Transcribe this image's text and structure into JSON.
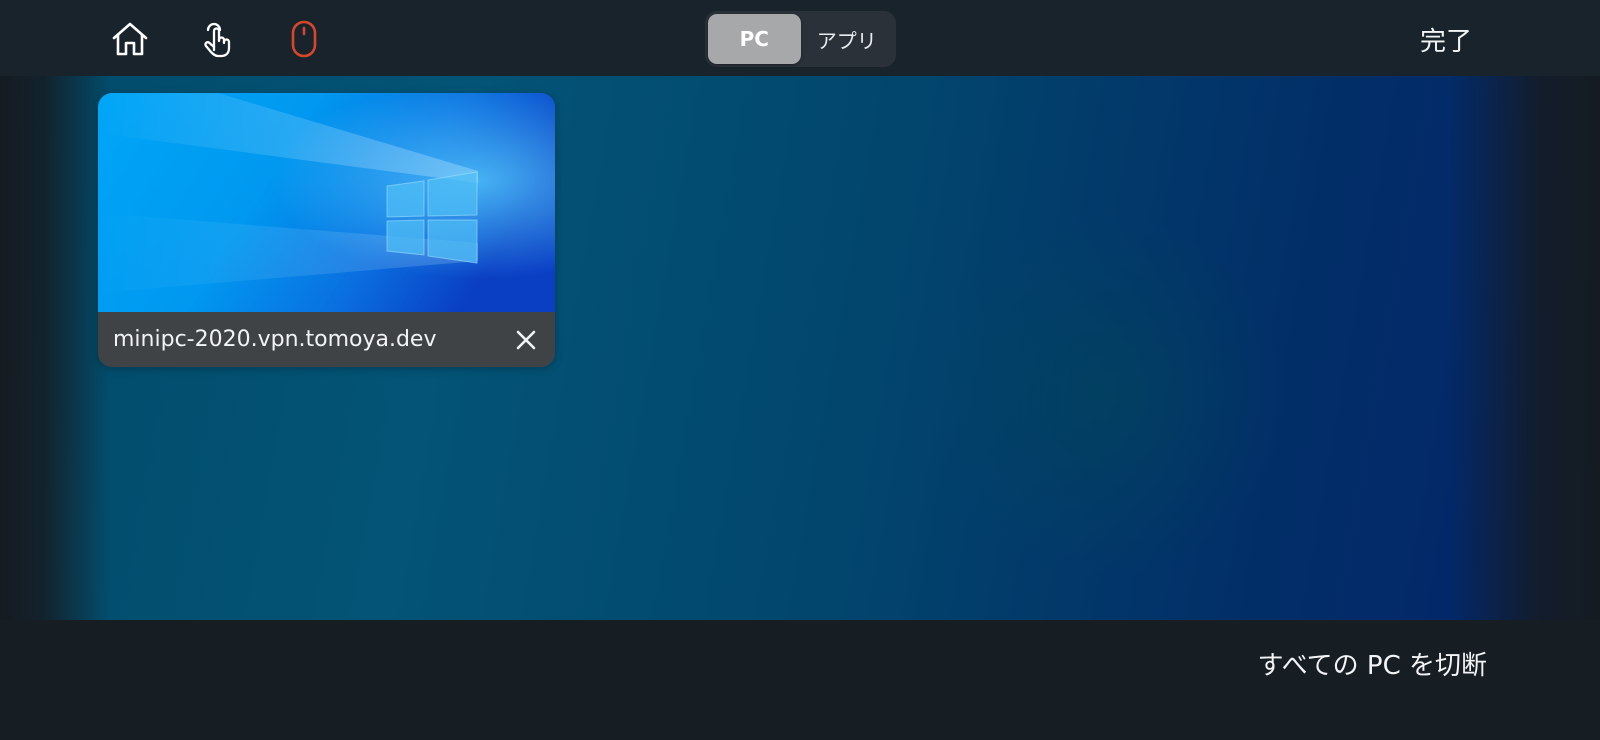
{
  "toolbar": {
    "icons": [
      "home-icon",
      "touch-hand-icon",
      "mouse-icon"
    ],
    "mouse_icon_color": "#d9472b",
    "segments": [
      {
        "label": "PC",
        "selected": true
      },
      {
        "label": "アプリ",
        "selected": false
      }
    ],
    "done_label": "完了"
  },
  "pc_list": [
    {
      "name": "minipc-2020.vpn.tomoya.dev",
      "thumbnail": "windows-desktop-icon"
    }
  ],
  "footer": {
    "disconnect_label": "すべての PC を切断"
  },
  "colors": {
    "accent_mouse": "#d9472b",
    "segment_active": "#a6a8aa",
    "card_caption": "#3f4346"
  }
}
